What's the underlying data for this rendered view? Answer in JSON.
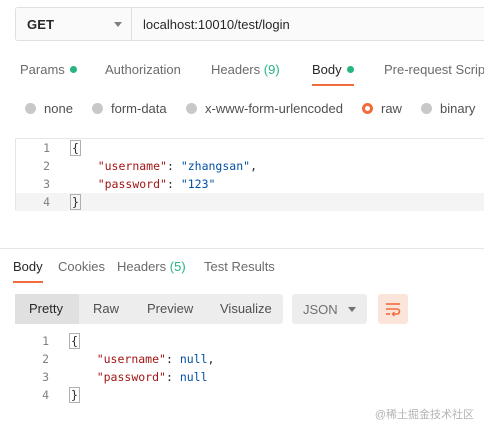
{
  "request": {
    "method": "GET",
    "url": "localhost:10010/test/login"
  },
  "request_tabs": [
    {
      "label": "Params"
    },
    {
      "label": "Authorization"
    },
    {
      "label": "Headers",
      "count": "(9)"
    },
    {
      "label": "Body"
    },
    {
      "label": "Pre-request Script"
    }
  ],
  "body_types": [
    {
      "label": "none"
    },
    {
      "label": "form-data"
    },
    {
      "label": "x-www-form-urlencoded"
    },
    {
      "label": "raw",
      "selected": true
    },
    {
      "label": "binary"
    }
  ],
  "request_body": {
    "line_numbers": [
      "1",
      "2",
      "3",
      "4"
    ],
    "open_brace": "{",
    "username_key": "\"username\"",
    "username_value": "\"zhangsan\"",
    "password_key": "\"password\"",
    "password_value": "\"123\"",
    "close_brace": "}"
  },
  "response_tabs": [
    {
      "label": "Body"
    },
    {
      "label": "Cookies"
    },
    {
      "label": "Headers",
      "count": "(5)"
    },
    {
      "label": "Test Results"
    }
  ],
  "response_toolbar": {
    "view_modes": [
      "Pretty",
      "Raw",
      "Preview",
      "Visualize"
    ],
    "format": "JSON"
  },
  "response_body": {
    "line_numbers": [
      "1",
      "2",
      "3",
      "4"
    ],
    "open_brace": "{",
    "username_key": "\"username\"",
    "username_value": "null",
    "password_key": "\"password\"",
    "password_value": "null",
    "close_brace": "}"
  },
  "watermark": "@稀土掘金技术社区",
  "colors": {
    "accent": "#f26b3a",
    "active_dot": "#26b47f",
    "json_key": "#a31515",
    "json_value": "#0451a5"
  },
  "icons": {
    "method_dropdown": "chevron-down-icon",
    "wrap": "wrap-lines-icon"
  }
}
